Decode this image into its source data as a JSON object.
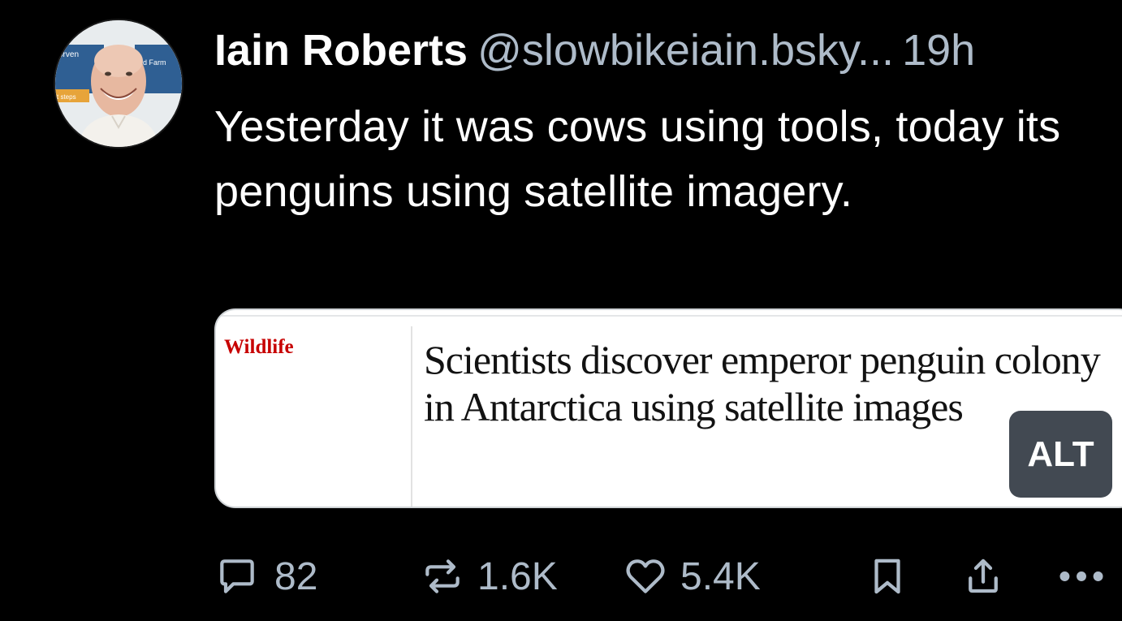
{
  "post": {
    "author_name": "Iain Roberts",
    "handle": "@slowbikeiain.bsky...",
    "time": "19h",
    "text": "Yesterday it was cows using tools, today its penguins using satellite imagery."
  },
  "embed": {
    "section_label": "Wildlife",
    "headline": "Scientists discover emperor penguin colony in Antarctica using satellite images",
    "alt_label": "ALT"
  },
  "avatar": {
    "sign_text_left": "orven",
    "sign_text_right": "d Farm",
    "sign_text_small": "t steps"
  },
  "actions": {
    "reply_count": "82",
    "repost_count": "1.6K",
    "like_count": "5.4K"
  },
  "icons": {
    "reply": "speech-bubble-icon",
    "repost": "repost-arrows-icon",
    "like": "heart-icon",
    "bookmark": "bookmark-icon",
    "share": "share-upload-icon",
    "more": "more-dots-icon"
  },
  "colors": {
    "background": "#000000",
    "muted": "#aebbc9",
    "guardian_red": "#c70000"
  }
}
